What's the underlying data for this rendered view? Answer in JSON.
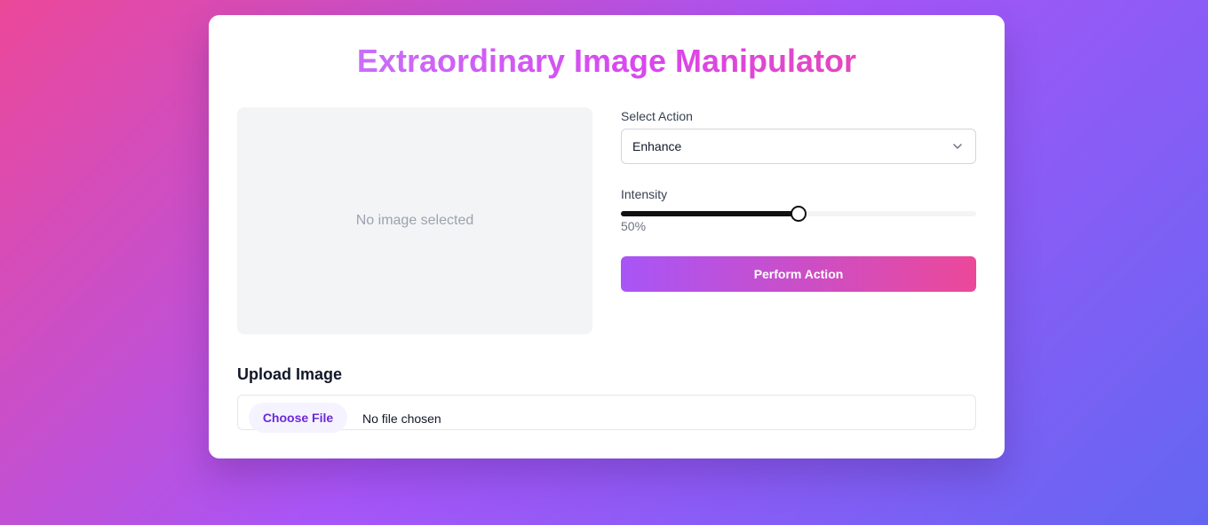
{
  "app": {
    "title": "Extraordinary Image Manipulator"
  },
  "preview": {
    "placeholder": "No image selected"
  },
  "controls": {
    "action_label": "Select Action",
    "action_value": "Enhance",
    "intensity_label": "Intensity",
    "intensity_value": 50,
    "intensity_display": "50%",
    "perform_button": "Perform Action"
  },
  "upload": {
    "title": "Upload Image",
    "choose_button": "Choose File",
    "file_status": "No file chosen"
  },
  "icons": {
    "select_chevron": "chevron-down-icon"
  },
  "colors": {
    "accent_start": "#a855f7",
    "accent_end": "#ec4899",
    "slider_fill": "#111111"
  }
}
